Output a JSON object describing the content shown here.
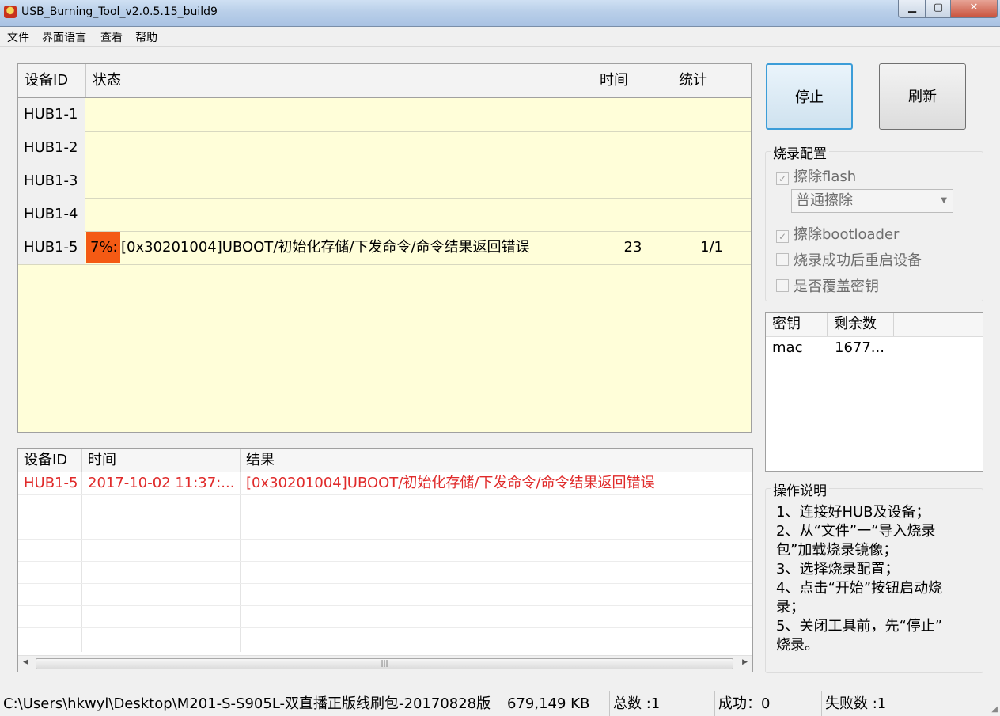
{
  "window": {
    "title": "USB_Burning_Tool_v2.0.5.15_build9"
  },
  "menu": [
    "文件",
    "界面语言",
    "查看",
    "帮助"
  ],
  "device_grid": {
    "columns": [
      "设备ID",
      "状态",
      "时间",
      "统计"
    ],
    "rows": [
      {
        "id": "HUB1-1",
        "progress": "",
        "status": "",
        "time": "",
        "stat": ""
      },
      {
        "id": "HUB1-2",
        "progress": "",
        "status": "",
        "time": "",
        "stat": ""
      },
      {
        "id": "HUB1-3",
        "progress": "",
        "status": "",
        "time": "",
        "stat": ""
      },
      {
        "id": "HUB1-4",
        "progress": "",
        "status": "",
        "time": "",
        "stat": ""
      },
      {
        "id": "HUB1-5",
        "progress": "7%:",
        "status": "[0x30201004]UBOOT/初始化存储/下发命令/命令结果返回错误",
        "time": "23",
        "stat": "1/1"
      }
    ]
  },
  "buttons": {
    "stop": "停止",
    "refresh": "刷新"
  },
  "burn_config": {
    "label": "烧录配置",
    "erase_flash": {
      "label": "擦除flash",
      "checked": true
    },
    "erase_mode": "普通擦除",
    "erase_bootloader": {
      "label": "擦除bootloader",
      "checked": true
    },
    "reboot_after": {
      "label": "烧录成功后重启设备",
      "checked": false
    },
    "overwrite_key": {
      "label": "是否覆盖密钥",
      "checked": false
    }
  },
  "key_list": {
    "columns": [
      "密钥",
      "剩余数"
    ],
    "rows": [
      {
        "key": "mac",
        "remaining": "1677..."
      }
    ]
  },
  "log": {
    "columns": [
      "设备ID",
      "时间",
      "结果"
    ],
    "rows": [
      {
        "id": "HUB1-5",
        "time": "2017-10-02 11:37:...",
        "result": "[0x30201004]UBOOT/初始化存储/下发命令/命令结果返回错误"
      }
    ]
  },
  "instructions": {
    "label": "操作说明",
    "lines": [
      "1、连接好HUB及设备；",
      "2、从“文件”一“导入烧录",
      "包”加载烧录镜像；",
      "3、选择烧录配置；",
      "4、点击“开始”按钮启动烧",
      "录；",
      "5、关闭工具前，先“停止”",
      "烧录。"
    ]
  },
  "statusbar": {
    "path": "C:\\Users\\hkwyl\\Desktop\\M201-S-S905L-双直播正版线刷包-20170828版",
    "size": "679,149 KB",
    "total": "总数 :1",
    "success": "成功：0",
    "failed": "失败数 :1"
  },
  "colors": {
    "grid_bg": "#fffed9",
    "progress": "#f45a14",
    "error_text": "#e02a2a",
    "focus_border": "#3c9dd8"
  }
}
